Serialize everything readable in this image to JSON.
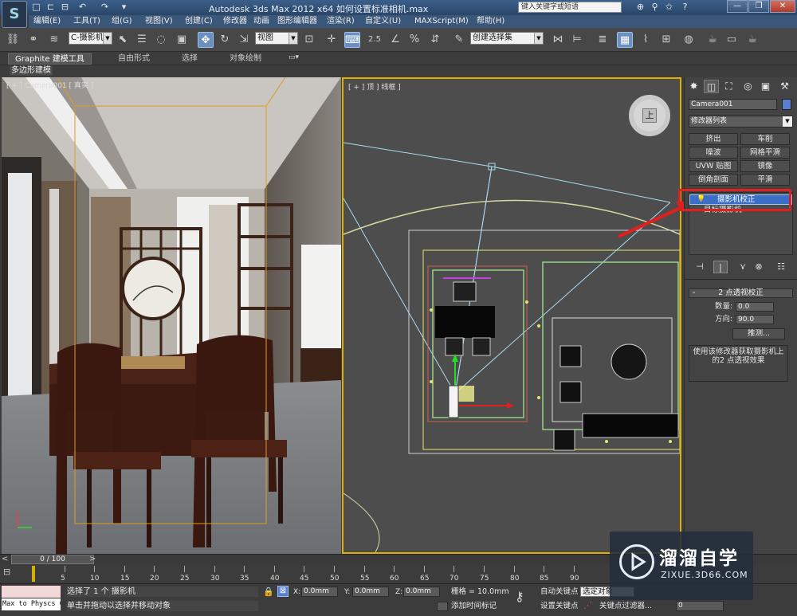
{
  "window": {
    "title": "Autodesk 3ds Max  2012 x64     如何设置标准相机.max",
    "search_placeholder": "键入关键字或短语",
    "app_logo": "S",
    "quick_access": [
      "□",
      "⊏",
      "⊟",
      "↶",
      "↷",
      "▾"
    ],
    "title_icons": [
      "⊕",
      "⚲",
      "✩",
      "?"
    ],
    "window_buttons": [
      "—",
      "❐",
      "✕"
    ]
  },
  "menubar": [
    "编辑(E)",
    "工具(T)",
    "组(G)",
    "视图(V)",
    "创建(C)",
    "修改器",
    "动画",
    "图形编辑器",
    "渲染(R)",
    "自定义(U)",
    "MAXScript(M)",
    "帮助(H)"
  ],
  "toolbar": {
    "selection_filter": "C-摄影机",
    "ref_coord": "视图",
    "angle_snap_label": "2.5",
    "named_selection": "创建选择集"
  },
  "ribbon": {
    "tabs": [
      "Graphite 建模工具",
      "自由形式",
      "选择",
      "对象绘制"
    ],
    "sub_label": "多边形建模"
  },
  "viewports": {
    "left_label": "[ + ] Camera001 [ 真实 ]",
    "right_label": "[ + ] 顶 ] 线框 ]",
    "viewcube_label": "上"
  },
  "command_panel": {
    "tabs": [
      "✸",
      "◫",
      "⛶",
      "◎",
      "▣",
      "⚒"
    ],
    "object_name": "Camera001",
    "modifier_list": "修改器列表",
    "modifier_buttons": [
      "挤出",
      "车削",
      "噪波",
      "网格平滑",
      "UVW 贴图",
      "镜像",
      "倒角剖面",
      "平滑"
    ],
    "stack": [
      "摄影机校正",
      "目标摄影机"
    ],
    "stack_buttons": [
      "⊣",
      "|",
      "⋎",
      "⊗",
      "☷"
    ],
    "rollout_title": "2 点透视校正",
    "amount_label": "数量:",
    "amount_value": "0.0",
    "direction_label": "方向:",
    "direction_value": "90.0",
    "guess_button": "推测...",
    "description": "使用该修改器获取摄影机上的2 点透视效果",
    "accent_color": "#5b7fd0",
    "highlight_color": "#e0201e"
  },
  "timeline": {
    "position": "0 / 100",
    "ticks": [
      "5",
      "10",
      "15",
      "20",
      "25",
      "30",
      "35",
      "40",
      "45",
      "50",
      "55",
      "60",
      "65",
      "70",
      "75",
      "80",
      "85",
      "90"
    ]
  },
  "status": {
    "maxscript_line1": "",
    "maxscript_line2": "Max to Physcs C",
    "prompt1": "选择了 1 个 摄影机",
    "prompt2": "单击并拖动以选择并移动对象",
    "x_label": "X:",
    "x_value": "0.0mm",
    "y_label": "Y:",
    "y_value": "0.0mm",
    "z_label": "Z:",
    "z_value": "0.0mm",
    "grid": "栅格 = 10.0mm",
    "add_time_tag": "添加时间标记",
    "auto_key": "自动关键点",
    "set_key": "设置关键点",
    "sel_dropdown": "选定对象",
    "key_filters": "关键点过滤器...",
    "frame_value": "0"
  },
  "watermark": {
    "title": "溜溜自学",
    "url": "ZIXUE.3D66.COM"
  }
}
